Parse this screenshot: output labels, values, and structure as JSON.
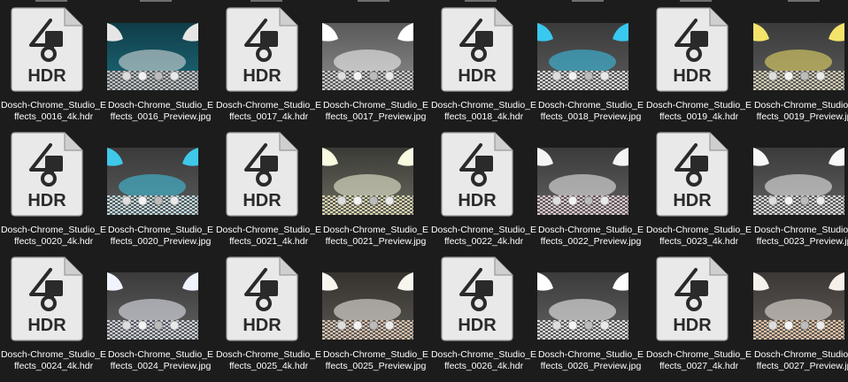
{
  "rows": [
    [
      {
        "type": "hdr",
        "line1": "Dosch-Chrome_Studio_E",
        "line2": "ffects_0016_4k.hdr",
        "icon_text": "HDR",
        "icon": "hdr-file-icon"
      },
      {
        "type": "preview",
        "line1": "Dosch-Chrome_Studio_E",
        "line2": "ffects_0016_Preview.jpg",
        "variant": "teal-windows"
      },
      {
        "type": "hdr",
        "line1": "Dosch-Chrome_Studio_E",
        "line2": "ffects_0017_4k.hdr",
        "icon_text": "HDR",
        "icon": "hdr-file-icon"
      },
      {
        "type": "preview",
        "line1": "Dosch-Chrome_Studio_E",
        "line2": "ffects_0017_Preview.jpg",
        "variant": "grey-panels"
      },
      {
        "type": "hdr",
        "line1": "Dosch-Chrome_Studio_E",
        "line2": "ffects_0018_4k.hdr",
        "icon_text": "HDR",
        "icon": "hdr-file-icon"
      },
      {
        "type": "preview",
        "line1": "Dosch-Chrome_Studio_E",
        "line2": "ffects_0018_Preview.jpg",
        "variant": "cyan-white"
      },
      {
        "type": "hdr",
        "line1": "Dosch-Chrome_Studio_E",
        "line2": "ffects_0019_4k.hdr",
        "icon_text": "HDR",
        "icon": "hdr-file-icon"
      },
      {
        "type": "preview",
        "line1": "Dosch-Chrome_Studio_E",
        "line2": "ffects_0019_Preview.jpg",
        "variant": "cyan-yellow"
      }
    ],
    [
      {
        "type": "hdr",
        "line1": "Dosch-Chrome_Studio_E",
        "line2": "ffects_0020_4k.hdr",
        "icon_text": "HDR",
        "icon": "hdr-file-icon"
      },
      {
        "type": "preview",
        "line1": "Dosch-Chrome_Studio_E",
        "line2": "ffects_0020_Preview.jpg",
        "variant": "cyan"
      },
      {
        "type": "hdr",
        "line1": "Dosch-Chrome_Studio_E",
        "line2": "ffects_0021_4k.hdr",
        "icon_text": "HDR",
        "icon": "hdr-file-icon"
      },
      {
        "type": "preview",
        "line1": "Dosch-Chrome_Studio_E",
        "line2": "ffects_0021_Preview.jpg",
        "variant": "cream"
      },
      {
        "type": "hdr",
        "line1": "Dosch-Chrome_Studio_E",
        "line2": "ffects_0022_4k.hdr",
        "icon_text": "HDR",
        "icon": "hdr-file-icon"
      },
      {
        "type": "preview",
        "line1": "Dosch-Chrome_Studio_E",
        "line2": "ffects_0022_Preview.jpg",
        "variant": "pink"
      },
      {
        "type": "hdr",
        "line1": "Dosch-Chrome_Studio_E",
        "line2": "ffects_0023_4k.hdr",
        "icon_text": "HDR",
        "icon": "hdr-file-icon"
      },
      {
        "type": "preview",
        "line1": "Dosch-Chrome_Studio_E",
        "line2": "ffects_0023_Preview.jpg",
        "variant": "white"
      }
    ],
    [
      {
        "type": "hdr",
        "line1": "Dosch-Chrome_Studio_E",
        "line2": "ffects_0024_4k.hdr",
        "icon_text": "HDR",
        "icon": "hdr-file-icon"
      },
      {
        "type": "preview",
        "line1": "Dosch-Chrome_Studio_E",
        "line2": "ffects_0024_Preview.jpg",
        "variant": "blue-white"
      },
      {
        "type": "hdr",
        "line1": "Dosch-Chrome_Studio_E",
        "line2": "ffects_0025_4k.hdr",
        "icon_text": "HDR",
        "icon": "hdr-file-icon"
      },
      {
        "type": "preview",
        "line1": "Dosch-Chrome_Studio_E",
        "line2": "ffects_0025_Preview.jpg",
        "variant": "warm"
      },
      {
        "type": "hdr",
        "line1": "Dosch-Chrome_Studio_E",
        "line2": "ffects_0026_4k.hdr",
        "icon_text": "HDR",
        "icon": "hdr-file-icon"
      },
      {
        "type": "preview",
        "line1": "Dosch-Chrome_Studio_E",
        "line2": "ffects_0026_Preview.jpg",
        "variant": "white2"
      },
      {
        "type": "hdr",
        "line1": "Dosch-Chrome_Studio_E",
        "line2": "ffects_0027_4k.hdr",
        "icon_text": "HDR",
        "icon": "hdr-file-icon"
      },
      {
        "type": "preview",
        "line1": "Dosch-Chrome_Studio_E",
        "line2": "ffects_0027_Preview.jpg",
        "variant": "peach"
      }
    ]
  ],
  "variants": {
    "teal-windows": {
      "sky": "#1d6a78",
      "sky2": "#0f3d48",
      "floor": "#b8c0c4",
      "accent": "#e6e6e6"
    },
    "grey-panels": {
      "sky": "#8a8a8a",
      "sky2": "#5a5a5a",
      "floor": "#c8c8c8",
      "accent": "#ffffff"
    },
    "cyan-white": {
      "sky": "#5a5a5a",
      "sky2": "#3b3b3b",
      "floor": "#d4d4d4",
      "accent": "#38c8f0"
    },
    "cyan-yellow": {
      "sky": "#5a5a5a",
      "sky2": "#3b3b3b",
      "floor": "#cfcab0",
      "accent": "#f4e46a"
    },
    "cyan": {
      "sky": "#5a5a5a",
      "sky2": "#3b3b3b",
      "floor": "#bcd8df",
      "accent": "#3fc8e8"
    },
    "cream": {
      "sky": "#6a6a60",
      "sky2": "#3b3b36",
      "floor": "#d8d4a8",
      "accent": "#fafae0"
    },
    "pink": {
      "sky": "#606060",
      "sky2": "#3b3b3b",
      "floor": "#dcc4cc",
      "accent": "#f4f4f4"
    },
    "white": {
      "sky": "#606060",
      "sky2": "#3b3b3b",
      "floor": "#d4d4d4",
      "accent": "#f8f8f8"
    },
    "blue-white": {
      "sky": "#606060",
      "sky2": "#3b3b3b",
      "floor": "#c8ccd8",
      "accent": "#f0f4ff"
    },
    "warm": {
      "sky": "#585450",
      "sky2": "#36322e",
      "floor": "#d8c0a8",
      "accent": "#f8f4ee"
    },
    "white2": {
      "sky": "#606060",
      "sky2": "#3b3b3b",
      "floor": "#d8d8d8",
      "accent": "#ffffff"
    },
    "peach": {
      "sky": "#605a56",
      "sky2": "#3b3836",
      "floor": "#e4c0a0",
      "accent": "#f6f0ea"
    }
  }
}
